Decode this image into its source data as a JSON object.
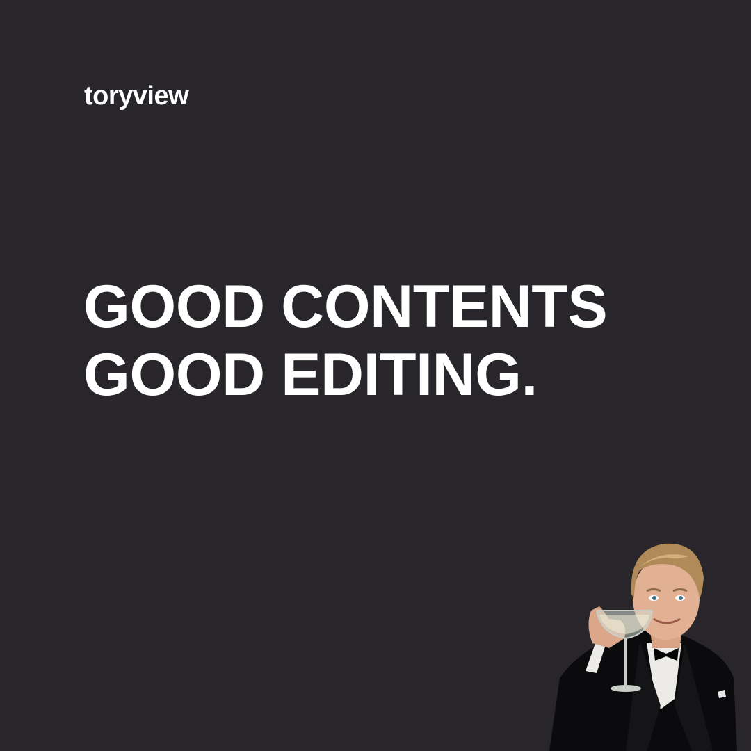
{
  "brand": {
    "name": "toryview"
  },
  "headline": {
    "line1": "GOOD CONTENTS",
    "line2": "GOOD EDITING."
  },
  "illustration": {
    "icon": "toasting-man-icon"
  },
  "colors": {
    "background": "#28262a",
    "text": "#ffffff"
  }
}
